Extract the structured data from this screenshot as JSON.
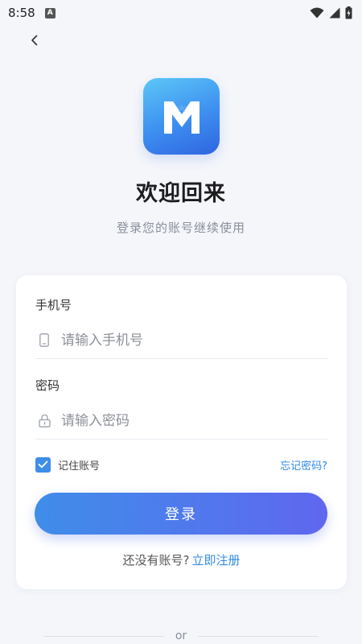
{
  "status_bar": {
    "time": "8:58",
    "app_badge": "A",
    "icons": [
      "wifi-icon",
      "cell-signal-icon",
      "battery-icon"
    ]
  },
  "header": {
    "back_icon": "chevron-left-icon"
  },
  "logo": {
    "letter": "M",
    "gradient": [
      "#5cc7f7",
      "#2f64e0"
    ]
  },
  "welcome": {
    "title": "欢迎回来",
    "subtitle": "登录您的账号继续使用"
  },
  "form": {
    "phone": {
      "label": "手机号",
      "placeholder": "请输入手机号",
      "value": "",
      "icon": "phone-icon"
    },
    "password": {
      "label": "密码",
      "placeholder": "请输入密码",
      "value": "",
      "icon": "lock-icon"
    },
    "remember": {
      "label": "记住账号",
      "checked": true
    },
    "forgot_label": "忘记密码?",
    "login_label": "登录",
    "register_prompt": "还没有账号?",
    "register_label": "立即注册"
  },
  "divider": {
    "text": "or"
  },
  "colors": {
    "accent": "#2f8be6",
    "button_start": "#3f8de9",
    "button_end": "#5f67ef",
    "background": "#f4f6fa"
  }
}
